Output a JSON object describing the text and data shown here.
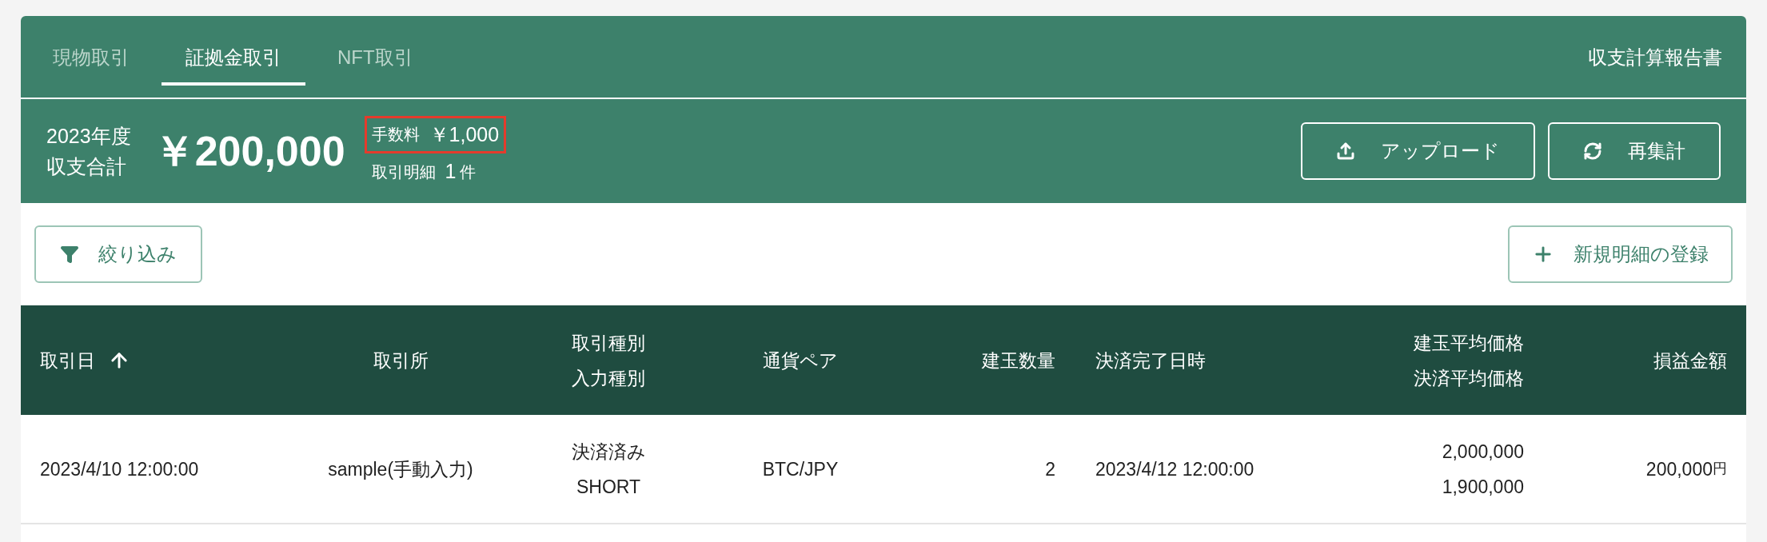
{
  "tabs": [
    {
      "label": "現物取引",
      "selected": false
    },
    {
      "label": "証拠金取引",
      "selected": true
    },
    {
      "label": "NFT取引",
      "selected": false
    }
  ],
  "report_link": "収支計算報告書",
  "summary": {
    "period": "2023年度",
    "label": "収支合計",
    "total": "￥200,000",
    "fee_label": "手数料",
    "fee": "￥1,000",
    "fee_highlighted": true,
    "count_label": "取引明細",
    "count": "1",
    "count_unit": "件"
  },
  "actions": [
    {
      "label": "アップロード",
      "kind": "upload"
    },
    {
      "label": "再集計",
      "kind": "refresh"
    }
  ],
  "filter_button": "絞り込み",
  "add_button": "新規明細の登録",
  "table": {
    "columns": [
      {
        "lines": [
          "取引日"
        ],
        "sorted": true
      },
      {
        "lines": [
          "取引所"
        ],
        "sorted": false
      },
      {
        "lines": [
          "取引種別",
          "入力種別"
        ],
        "sorted": false
      },
      {
        "lines": [
          "通貨ペア"
        ],
        "sorted": false
      },
      {
        "lines": [
          "建玉数量"
        ],
        "sorted": false
      },
      {
        "lines": [
          "決済完了日時"
        ],
        "sorted": false
      },
      {
        "lines": [
          "建玉平均価格",
          "決済平均価格"
        ],
        "sorted": false
      },
      {
        "lines": [
          "損益金額"
        ],
        "sorted": false
      }
    ],
    "rows": [
      {
        "cells": [
          [
            "2023/4/10 12:00:00"
          ],
          [
            "sample(手動入力)"
          ],
          [
            "決済済み",
            "SHORT"
          ],
          [
            "BTC/JPY"
          ],
          [
            "2"
          ],
          [
            "2023/4/12 12:00:00"
          ],
          [
            "2,000,000",
            "1,900,000"
          ],
          [
            "200,000"
          ]
        ],
        "amount_unit": "円"
      }
    ]
  }
}
